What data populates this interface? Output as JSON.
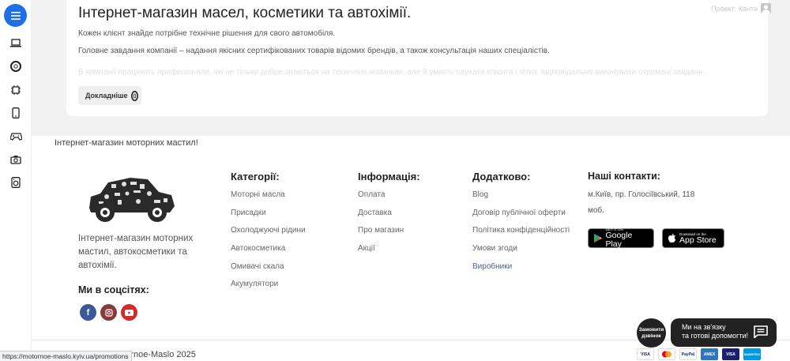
{
  "rail": {
    "items": [
      {
        "name": "laptop-icon"
      },
      {
        "name": "tire-icon"
      },
      {
        "name": "chip-icon"
      },
      {
        "name": "phone-icon"
      },
      {
        "name": "gamepad-icon"
      },
      {
        "name": "camera-icon"
      },
      {
        "name": "washer-icon"
      }
    ],
    "accent": "#1e6fe8"
  },
  "header": {
    "login_label": "Проект: Канта"
  },
  "card": {
    "title": "Інтернет-магазин масел, косметики та автохімії.",
    "p1": "Кожен клієнт знайде потрібне технічне рішення для свого автомобіля.",
    "p2": "Головне завдання компанії – надання якісних сертифікованих товарів відомих брендів, а також консультація наших спеціалістів.",
    "p3": "В компанії працюють професіонали, які не тільки добре знаються на технічних новинках, але й уміють слухати клієнта і чітко, відповідально виконувати отримані завдання.",
    "more_label": "Докладніше"
  },
  "footer": {
    "slogan": "Інтернет-магазин моторних мастил!",
    "about": "Інтернет-магазин моторних мастил, автокосметики та автохімії.",
    "social_title": "Ми в соцсітях:",
    "socials": [
      {
        "name": "facebook",
        "glyph": "f",
        "color": "#3b5998"
      },
      {
        "name": "instagram",
        "glyph": "◎",
        "color": "#8a3a3a"
      },
      {
        "name": "youtube",
        "glyph": "▶",
        "color": "#d42a2a"
      }
    ],
    "categories": {
      "title": "Категорії:",
      "links": [
        "Моторні масла",
        "Присадки",
        "Охолоджуючі рідини",
        "Автокосметика",
        "Омивачі скала",
        "Акумулятори"
      ]
    },
    "info": {
      "title": "Інформація:",
      "links": [
        "Оплата",
        "Доставка",
        "Про магазин",
        "Акції"
      ]
    },
    "extra": {
      "title": "Додатково:",
      "links": [
        "Blog",
        "Договір публічної оферти",
        "Політика конфіденційності",
        "Умови згоди",
        "Виробники"
      ]
    },
    "contacts": {
      "title": "Наші контакти:",
      "address": "м.Київ, пр. Голосіївський, 118 моб."
    },
    "google_play": {
      "small": "GET IT ON",
      "big": "Google Play"
    },
    "app_store": {
      "small": "Download on the",
      "big": "App Store"
    },
    "copyright": "otornoe-Maslo 2025",
    "url": "https://motornoe-maslo.kyiv.ua/promotions",
    "payments": [
      "VISA",
      "MC",
      "PayPal",
      "AMEX",
      "VISA",
      "MAESTRO"
    ]
  },
  "widgets": {
    "callback_label": "Замовити дзвінок",
    "chat_line1": "Ми на зв'язку",
    "chat_line2": "та готові допомогти!"
  }
}
